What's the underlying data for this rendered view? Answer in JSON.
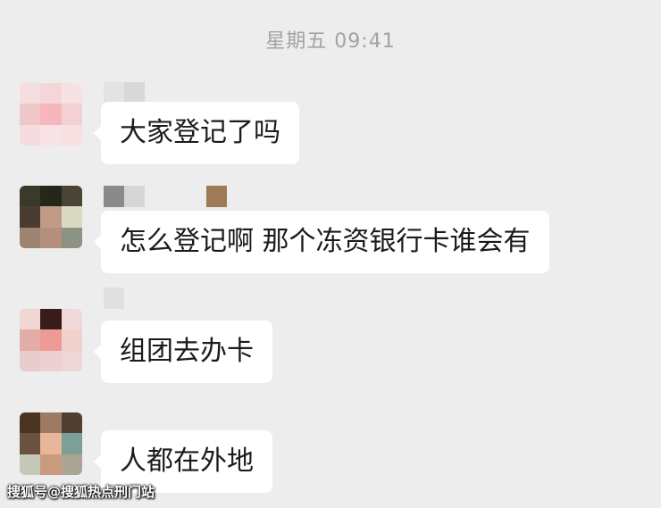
{
  "timestamp": "星期五 09:41",
  "messages": [
    {
      "text": "大家登记了吗",
      "avatar_colors": [
        "#f6dde0",
        "#f4d6d8",
        "#f7e1e3",
        "#efc6c9",
        "#f7b6bb",
        "#f3d0d3",
        "#f5dcdf",
        "#f7e3e5",
        "#f6e0e2"
      ],
      "name_colors": [
        "#e3e3e3",
        "#d8d8d8"
      ]
    },
    {
      "text": "怎么登记啊 那个冻资银行卡谁会有",
      "avatar_colors": [
        "#3a3a2a",
        "#252719",
        "#4a4436",
        "#4a3c30",
        "#c19a86",
        "#d9d9c4",
        "#9e8370",
        "#b58f7d",
        "#8d9384"
      ],
      "name_colors": [
        "#8a8a8a",
        "#d6d6d6",
        "#ededed",
        "#ededed",
        "#ededed",
        "#a07a56"
      ]
    },
    {
      "text": "组团去办卡",
      "avatar_colors": [
        "#f1d7d3",
        "#3a1b1c",
        "#f3d8d9",
        "#e4aca6",
        "#ee9a94",
        "#f2d1cd",
        "#e9cccc",
        "#edd1d2",
        "#ecd6d6"
      ],
      "name_colors": [
        "#e0e0e0"
      ]
    },
    {
      "text": "人都在外地",
      "avatar_colors": [
        "#4a3424",
        "#9f7a62",
        "#504032",
        "#6b513f",
        "#e8b79b",
        "#7c9f98",
        "#c5c9b8",
        "#c89a7e",
        "#a9a592"
      ],
      "name_colors": []
    }
  ],
  "watermark": "搜狐号@搜狐热点刑门站"
}
